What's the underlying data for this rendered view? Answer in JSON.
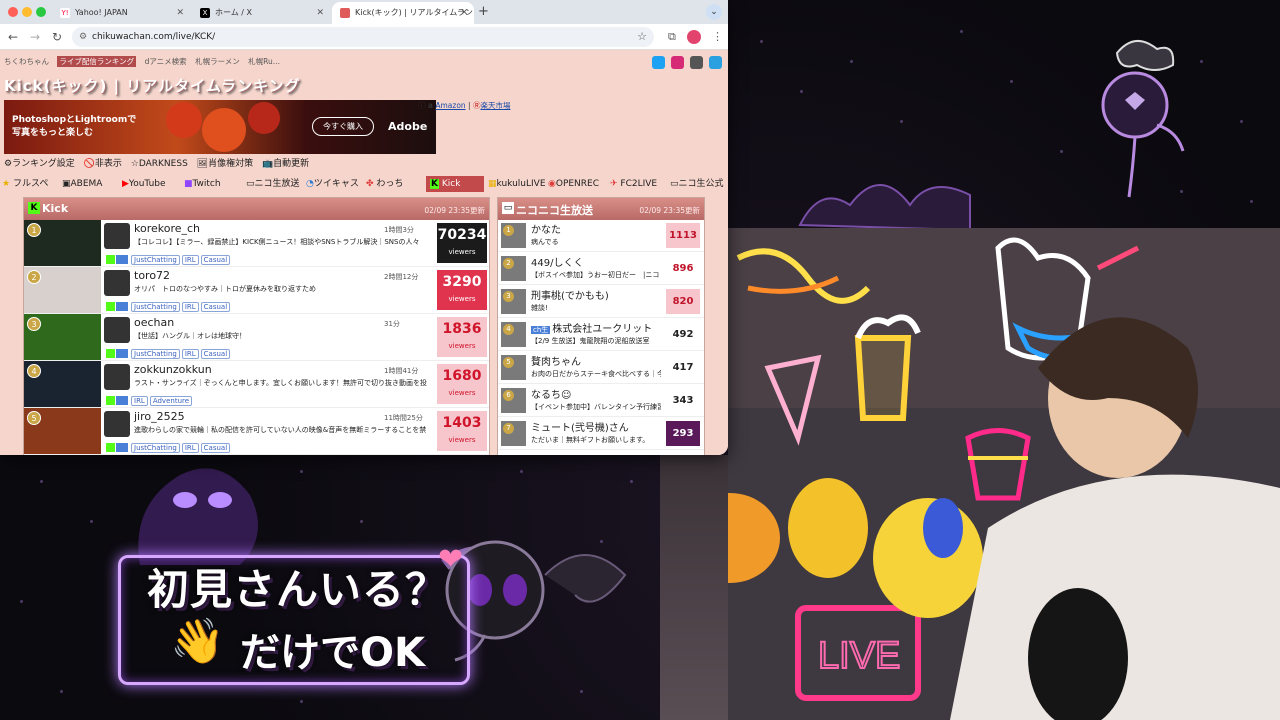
{
  "browser": {
    "tabs": [
      {
        "title": "Yahoo! JAPAN",
        "fav_color": "#ff0033"
      },
      {
        "title": "ホーム / X",
        "fav_color": "#000000"
      },
      {
        "title": "Kick(キック) | リアルタイムラン",
        "fav_color": "#e05a5a"
      }
    ],
    "new_tab": "+",
    "url": "chikuwachan.com/live/KCK/"
  },
  "site": {
    "nav": [
      "ちくわちゃん",
      "ライブ配信ランキング",
      "dアニメ検索",
      "札幌ラーメン",
      "札幌Ru..."
    ],
    "title": "Kick(キック) | リアルタイムランキング",
    "ad": {
      "line1": "PhotoshopとLightroomで",
      "line2": "写真をもっと楽しむ",
      "button": "今すぐ購入",
      "brand": "Adobe"
    },
    "ad_links": {
      "amazon": "Amazon",
      "sep": "|",
      "rakuten": "楽天市場"
    },
    "settings": [
      "⚙ランキング設定",
      "🚫非表示",
      "☆DARKNESS",
      "🖼肖像権対策",
      "📺自動更新"
    ],
    "platforms": [
      "フルスペ",
      "ABEMA",
      "YouTube",
      "Twitch",
      "ニコ生放送",
      "ツイキャス",
      "わっち",
      "Kick",
      "kukuluLIVE",
      "OPENREC",
      "FC2LIVE",
      "ニコ生公式"
    ],
    "active_platform": "Kick"
  },
  "kick": {
    "header": "Kick",
    "updated": "02/09 23:35更新",
    "rows": [
      {
        "rank": "1",
        "name": "korekore_ch",
        "time": "1時間3分",
        "title": "【コレコレ】【ミラー、録画禁止】KICK側ニュース！相談やSNSトラブル解決｜SNSの人々",
        "tags": [
          "JustChatting",
          "IRL",
          "Casual"
        ],
        "views": "70234",
        "label": "viewers",
        "color": "#1b1b1b",
        "thumb": "#1e2a20"
      },
      {
        "rank": "2",
        "name": "toro72",
        "time": "2時間12分",
        "title": "オリパ　トロのなつやすみ｜トロが夏休みを取り返すため",
        "tags": [
          "JustChatting",
          "IRL",
          "Casual"
        ],
        "views": "3290",
        "label": "viewers",
        "color": "#e0344e",
        "thumb": "#d8d0cc"
      },
      {
        "rank": "3",
        "name": "oechan",
        "time": "31分",
        "title": "【世話】ハングル｜オレは地球守！",
        "tags": [
          "JustChatting",
          "IRL",
          "Casual"
        ],
        "views": "1836",
        "label": "viewers",
        "color": "#f7c6cd",
        "thumb": "#2f6a1c"
      },
      {
        "rank": "4",
        "name": "zokkunzokkun",
        "time": "1時間41分",
        "title": "ラスト・サンライズ｜ぞっくんと申します。宜しくお願いします！無許可で切り抜き動画を投",
        "tags": [
          "IRL",
          "Adventure"
        ],
        "views": "1680",
        "label": "viewers",
        "color": "#f7c6cd",
        "thumb": "#1a2430"
      },
      {
        "rank": "5",
        "name": "jiro_2525",
        "time": "11時間25分",
        "title": "進歌わらしの家で競輪｜私の配信を許可していない人の映像&音声を無断ミラーすることを禁",
        "tags": [
          "JustChatting",
          "IRL",
          "Casual"
        ],
        "views": "1403",
        "label": "viewers",
        "color": "#f7c6cd",
        "thumb": "#8a3a1a"
      }
    ]
  },
  "nico": {
    "header": "ニコニコ生放送",
    "updated": "02/09 23:35更新",
    "rows": [
      {
        "rank": "1",
        "name": "かなた",
        "title": "病んでる",
        "views": "1113",
        "bg": "#f7c6cd",
        "fg": "#c0142a"
      },
      {
        "rank": "2",
        "name": "449/しくく",
        "title": "【ボスイベ参加】うおー初日だー　|ニコ",
        "views": "896",
        "bg": "#ffffff",
        "fg": "#c0142a"
      },
      {
        "rank": "3",
        "name": "刑事桃(でかもも)",
        "title": "雑談!",
        "views": "820",
        "bg": "#f7c6cd",
        "fg": "#c0142a"
      },
      {
        "rank": "4",
        "name": "株式会社ユークリット",
        "badge": "ch生",
        "title": "【2/9 生放送】鬼龍院翔の泥船放送室",
        "views": "492",
        "bg": "#ffffff",
        "fg": "#222222"
      },
      {
        "rank": "5",
        "name": "贅肉ちゃん",
        "title": "お肉の日だからステーキ食べ比べする｜今",
        "views": "417",
        "bg": "#ffffff",
        "fg": "#222222"
      },
      {
        "rank": "6",
        "name": "なるち☺",
        "title": "【イベント参加中】バレンタイン予行練習",
        "views": "343",
        "bg": "#ffffff",
        "fg": "#222222"
      },
      {
        "rank": "7",
        "name": "ミュート(弐号機)さん",
        "title": "ただいま｜無料ギフトお願いします。",
        "views": "293",
        "bg": "#5a1a5a",
        "fg": "#ffffff"
      }
    ]
  },
  "overlay": {
    "line1": "初見さんいる？",
    "line2": "だけでOK",
    "wave_emoji": "👋",
    "heart": "❤"
  }
}
